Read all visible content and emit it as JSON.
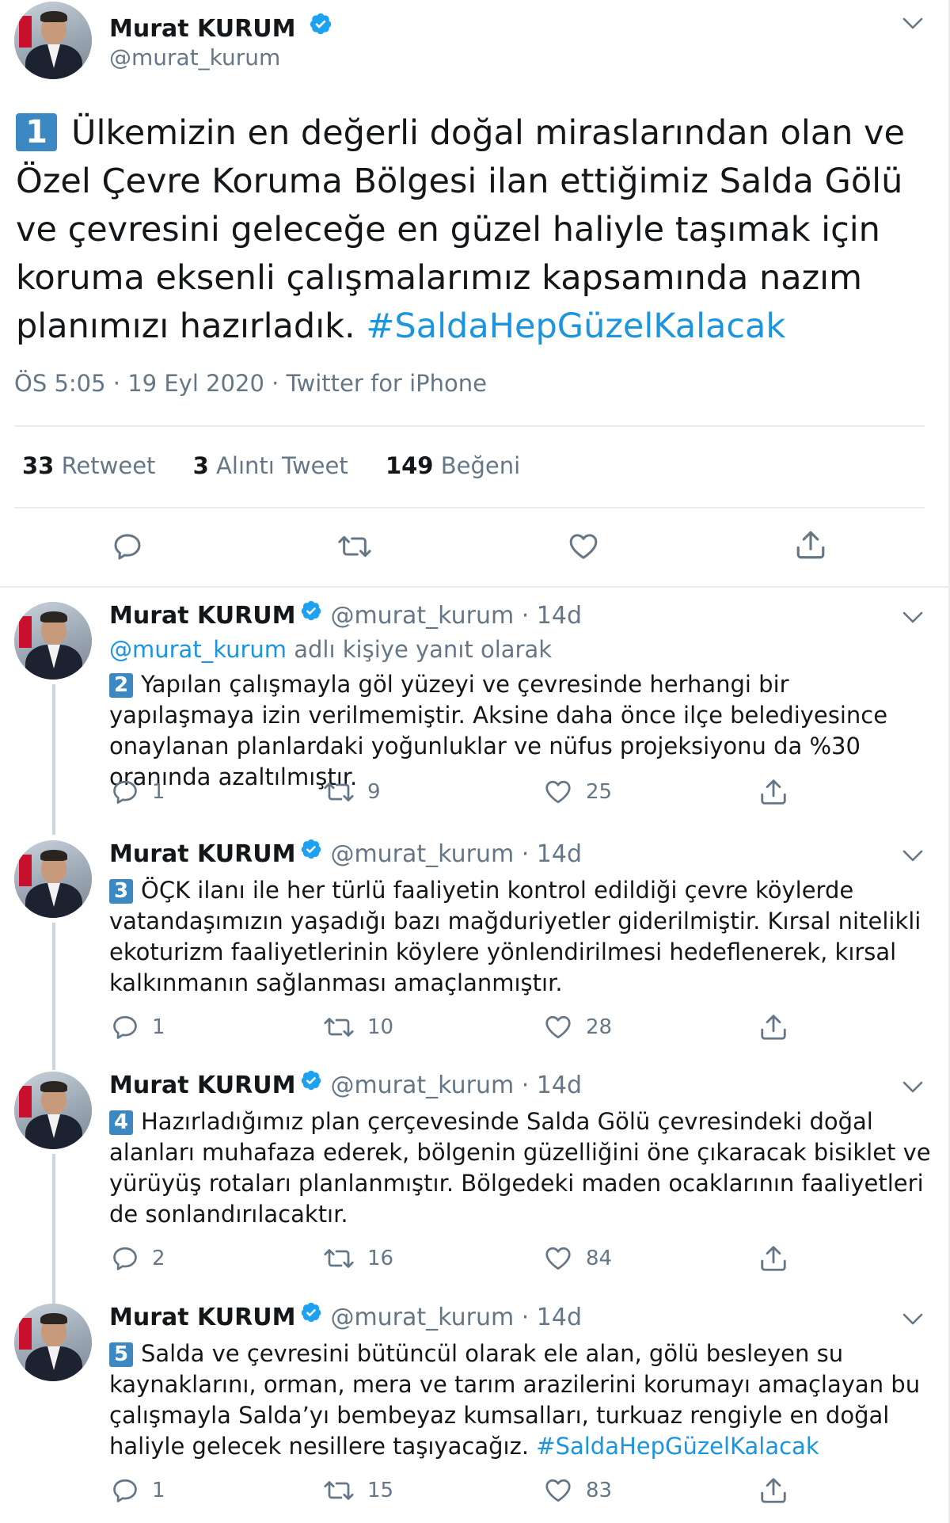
{
  "main_tweet": {
    "author_name": "Murat KURUM",
    "handle": "@murat_kurum",
    "number": "1",
    "text": "Ülkemizin en değerli doğal miraslarından olan ve Özel Çevre Koruma Bölgesi ilan ettiğimiz Salda Gölü ve çevresini geleceğe en güzel haliyle taşımak için koruma eksenli çalışmalarımız kapsamında nazım planımızı hazırladık.",
    "hashtag": "#SaldaHepGüzelKalacak",
    "meta": "ÖS 5:05 · 19 Eyl 2020 · Twitter for iPhone",
    "stats": [
      {
        "count": "33",
        "label": "Retweet"
      },
      {
        "count": "3",
        "label": "Alıntı Tweet"
      },
      {
        "count": "149",
        "label": "Beğeni"
      }
    ]
  },
  "replies": [
    {
      "author_name": "Murat KURUM",
      "handle": "@murat_kurum · 14d",
      "replying_handle": "@murat_kurum",
      "replying_suffix": " adlı kişiye yanıt olarak",
      "number": "2",
      "text": "Yapılan çalışmayla göl yüzeyi ve çevresinde herhangi bir yapılaşmaya izin verilmemiştir. Aksine daha önce ilçe belediyesince onaylanan planlardaki yoğunluklar ve nüfus projeksiyonu da %30 oranında azaltılmıştır.",
      "hashtag": "",
      "replies": "1",
      "retweets": "9",
      "likes": "25"
    },
    {
      "author_name": "Murat KURUM",
      "handle": "@murat_kurum · 14d",
      "number": "3",
      "text": "ÖÇK ilanı ile her türlü faaliyetin kontrol edildiği çevre köylerde vatandaşımızın yaşadığı bazı mağduriyetler giderilmiştir. Kırsal nitelikli ekoturizm faaliyetlerinin köylere yönlendirilmesi hedeflenerek, kırsal kalkınmanın sağlanması amaçlanmıştır.",
      "hashtag": "",
      "replies": "1",
      "retweets": "10",
      "likes": "28"
    },
    {
      "author_name": "Murat KURUM",
      "handle": "@murat_kurum · 14d",
      "number": "4",
      "text": "Hazırladığımız plan çerçevesinde Salda Gölü çevresindeki doğal alanları muhafaza ederek, bölgenin güzelliğini öne çıkaracak bisiklet ve yürüyüş rotaları planlanmıştır. Bölgedeki maden ocaklarının faaliyetleri de sonlandırılacaktır.",
      "hashtag": "",
      "replies": "2",
      "retweets": "16",
      "likes": "84"
    },
    {
      "author_name": "Murat KURUM",
      "handle": "@murat_kurum · 14d",
      "number": "5",
      "text": "Salda ve çevresini bütüncül olarak ele alan, gölü besleyen su kaynaklarını, orman, mera ve tarım arazilerini korumayı amaçlayan bu çalışmayla Salda’yı bembeyaz kumsalları, turkuaz rengiyle en doğal haliyle gelecek nesillere taşıyacağız.",
      "hashtag": "#SaldaHepGüzelKalacak",
      "replies": "1",
      "retweets": "15",
      "likes": "83"
    }
  ],
  "icons": {
    "verified": "verified-badge-icon",
    "caret": "chevron-down-icon",
    "reply": "reply-icon",
    "retweet": "retweet-icon",
    "like": "heart-icon",
    "share": "share-icon"
  },
  "colors": {
    "accent": "#1b95e0",
    "verified": "#1da1f2",
    "muted": "#657786",
    "text": "#14171a",
    "badge": "#3b88c3",
    "border": "#e6ecf0"
  }
}
